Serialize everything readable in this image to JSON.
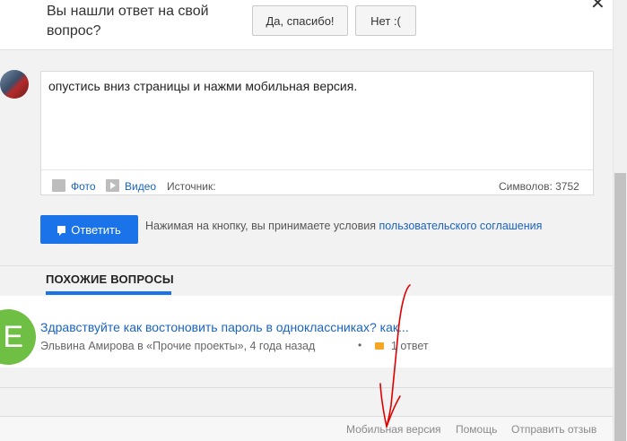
{
  "feedback": {
    "question": "Вы нашли ответ на свой вопрос?",
    "yes_label": "Да, спасибо!",
    "no_label": "Нет :(",
    "close_glyph": "✕"
  },
  "answer_form": {
    "text": "опустись вниз страницы и нажми мобильная версия.",
    "photo_label": "Фото",
    "video_label": "Видео",
    "source_label": "Источник:",
    "chars_count": "Символов: 3752",
    "reply_label": "Ответить",
    "terms_prefix": "Нажимая на кнопку, вы принимаете условия ",
    "terms_link": "пользовательского соглашения"
  },
  "similar": {
    "header": "ПОХОЖИЕ ВОПРОСЫ",
    "items": [
      {
        "avatar_letter": "Е",
        "title": "Здравствуйте как востоновить пароль в одноклассниках? как...",
        "meta": "Эльвина Амирова в «Прочие проекты»,    4 года назад",
        "dot": "•",
        "answers": "1 ответ"
      }
    ]
  },
  "footer": {
    "mobile": "Мобильная версия",
    "help": "Помощь",
    "feedback": "Отправить отзыв"
  },
  "colors": {
    "accent": "#1a73e8",
    "link": "#1a63c2",
    "annotation": "#e00000"
  }
}
